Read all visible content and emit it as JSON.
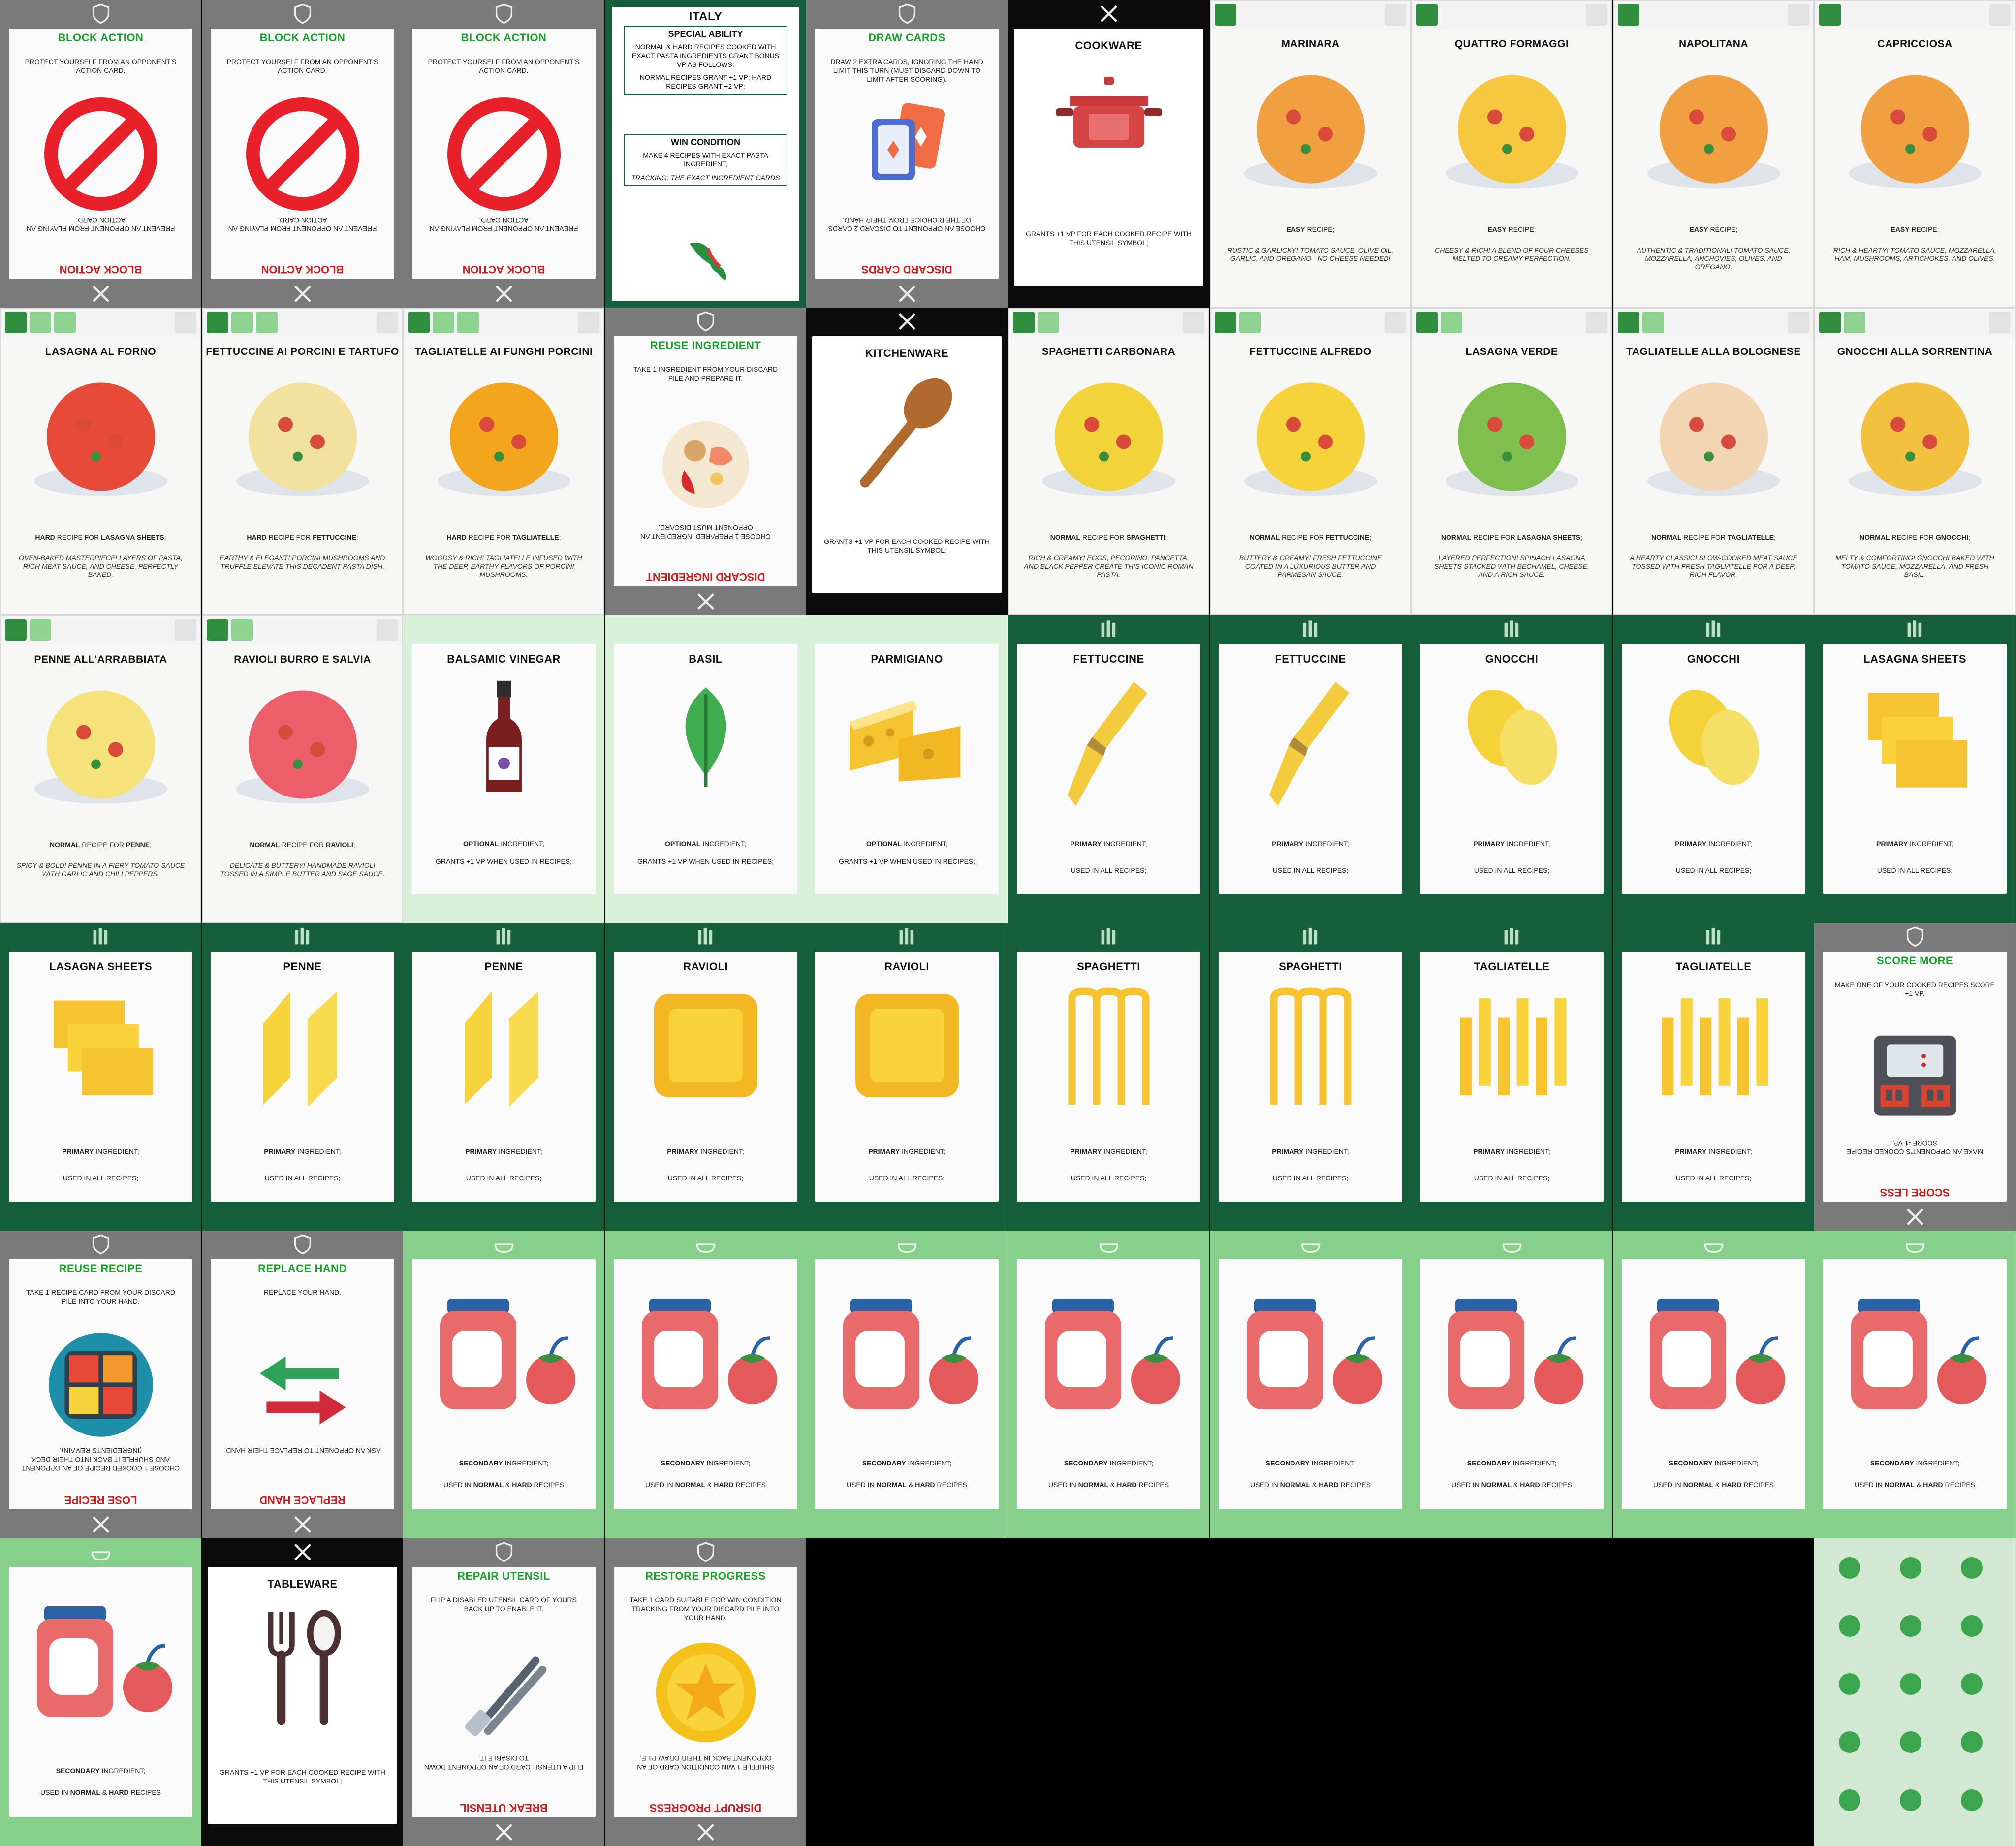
{
  "action_cards": [
    {
      "id": "a1",
      "title": "BLOCK ACTION",
      "desc": "PROTECT YOURSELF FROM AN OPPONENT'S ACTION CARD.",
      "inv_desc": "PREVENT AN OPPONENT FROM PLAYING AN ACTION CARD.",
      "inv_title": "BLOCK ACTION",
      "icon": "no-entry-icon"
    },
    {
      "id": "a2",
      "title": "BLOCK ACTION",
      "desc": "PROTECT YOURSELF FROM AN OPPONENT'S ACTION CARD.",
      "inv_desc": "PREVENT AN OPPONENT FROM PLAYING AN ACTION CARD.",
      "inv_title": "BLOCK ACTION",
      "icon": "no-entry-icon"
    },
    {
      "id": "a3",
      "title": "BLOCK ACTION",
      "desc": "PROTECT YOURSELF FROM AN OPPONENT'S ACTION CARD.",
      "inv_desc": "PREVENT AN OPPONENT FROM PLAYING AN ACTION CARD.",
      "inv_title": "BLOCK ACTION",
      "icon": "no-entry-icon"
    },
    {
      "id": "a4",
      "title": "DRAW CARDS",
      "desc": "DRAW 2 EXTRA CARDS, IGNORING THE HAND LIMIT THIS TURN (MUST DISCARD DOWN TO LIMIT AFTER SCORING).",
      "inv_desc": "CHOOSE AN OPPONENT TO DISCARD 2 CARDS OF THEIR CHOICE FROM THEIR HAND.",
      "inv_title": "DISCARD CARDS",
      "icon": "playing-cards-icon"
    },
    {
      "id": "a5",
      "title": "REUSE INGREDIENT",
      "desc": "TAKE 1 INGREDIENT FROM YOUR DISCARD PILE AND PREPARE IT.",
      "inv_desc": "CHOOSE 1 PREPARED INGREDIENT AN OPPONENT MUST DISCARD.",
      "inv_title": "DISCARD INGREDIENT",
      "icon": "ingredients-icon"
    },
    {
      "id": "a6",
      "title": "SCORE MORE",
      "desc": "MAKE ONE OF YOUR COOKED RECIPES SCORE +1 VP.",
      "inv_desc": "MAKE AN OPPONENT'S COOKED RECIPE SCORE -1 VP.",
      "inv_title": "SCORE LESS",
      "icon": "oven-icon"
    },
    {
      "id": "a7",
      "title": "REUSE RECIPE",
      "desc": "TAKE 1 RECIPE CARD FROM YOUR DISCARD PILE INTO YOUR HAND.",
      "inv_desc": "CHOOSE 1 COOKED RECIPE OF AN OPPONENT AND SHUFFLE IT BACK INTO THEIR DECK (INGREDIENTS REMAIN).",
      "inv_title": "LOSE RECIPE",
      "icon": "food-tray-icon"
    },
    {
      "id": "a8",
      "title": "REPLACE HAND",
      "desc": "REPLACE YOUR HAND.",
      "inv_desc": "ASK AN OPPONENT TO REPLACE THEIR HAND.",
      "inv_title": "REPLACE HAND",
      "icon": "swap-arrows-icon"
    },
    {
      "id": "a9",
      "title": "REPAIR UTENSIL",
      "desc": "FLIP A DISABLED UTENSIL CARD OF YOURS BACK UP TO ENABLE IT.",
      "inv_desc": "FLIP A UTENSIL CARD OF AN OPPONENT DOWN TO DISABLE IT.",
      "inv_title": "BREAK UTENSIL",
      "icon": "tongs-icon"
    },
    {
      "id": "a10",
      "title": "RESTORE PROGRESS",
      "desc": "TAKE 1 CARD SUITABLE FOR WIN CONDITION TRACKING FROM YOUR DISCARD PILE INTO YOUR HAND.",
      "inv_desc": "SHUFFLE 1 WIN CONDITION CARD OF AN OPPONENT BACK IN THEIR DRAW PILE.",
      "inv_title": "DISRUPT PROGRESS",
      "icon": "star-coin-icon"
    }
  ],
  "character": {
    "name": "ITALY",
    "ability_title": "SPECIAL ABILITY",
    "ability_text": "NORMAL & HARD RECIPES COOKED WITH EXACT PASTA INGREDIENTS GRANT BONUS VP AS FOLLOWS:",
    "ability_text2": "NORMAL RECIPES GRANT +1 VP; HARD RECIPES GRANT +2 VP;",
    "win_title": "WIN CONDITION",
    "win_text": "MAKE 4 RECIPES WITH EXACT PASTA INGREDIENT;",
    "win_text2": "TRACKING: THE EXACT INGREDIENT CARDS"
  },
  "utensils": [
    {
      "title": "COOKWARE",
      "desc": "GRANTS +1 VP FOR EACH COOKED RECIPE WITH THIS UTENSIL SYMBOL;",
      "icon": "pot-icon"
    },
    {
      "title": "KITCHENWARE",
      "desc": "GRANTS +1 VP FOR EACH COOKED RECIPE WITH THIS UTENSIL SYMBOL;",
      "icon": "wooden-spoon-icon"
    },
    {
      "title": "TABLEWARE",
      "desc": "GRANTS +1 VP FOR EACH COOKED RECIPE WITH THIS UTENSIL SYMBOL;",
      "icon": "fork-spoon-icon"
    }
  ],
  "recipes": [
    {
      "title": "MARINARA",
      "level": "EASY",
      "suffix": " RECIPE;",
      "flavor": "RUSTIC & GARLICKY! TOMATO SAUCE, OLIVE OIL, GARLIC, AND OREGANO - NO CHEESE NEEDED!",
      "color": "#f0a040"
    },
    {
      "title": "QUATTRO FORMAGGI",
      "level": "EASY",
      "suffix": " RECIPE;",
      "flavor": "CHEESY & RICH! A BLEND OF FOUR CHEESES MELTED TO CREAMY PERFECTION.",
      "color": "#f6c840"
    },
    {
      "title": "NAPOLITANA",
      "level": "EASY",
      "suffix": " RECIPE;",
      "flavor": "AUTHENTIC & TRADITIONAL! TOMATO SAUCE, MOZZARELLA, ANCHOVIES, OLIVES, AND OREGANO.",
      "color": "#f0a040"
    },
    {
      "title": "CAPRICCIOSA",
      "level": "EASY",
      "suffix": " RECIPE;",
      "flavor": "RICH & HEARTY! TOMATO SAUCE, MOZZARELLA, HAM, MUSHROOMS, ARTICHOKES, AND OLIVES.",
      "color": "#f0a040"
    },
    {
      "title": "LASAGNA AL FORNO",
      "level": "HARD",
      "suffix": " RECIPE FOR ",
      "pasta": "LASAGNA SHEETS",
      "flavor": "OVEN-BAKED MASTERPIECE! LAYERS OF PASTA, RICH MEAT SAUCE, AND CHEESE, PERFECTLY BAKED.",
      "color": "#e84a3a"
    },
    {
      "title": "FETTUCCINE AI PORCINI E TARTUFO",
      "level": "HARD",
      "suffix": " RECIPE FOR ",
      "pasta": "FETTUCCINE",
      "flavor": "EARTHY & ELEGANT! PORCINI MUSHROOMS AND TRUFFLE ELEVATE THIS DECADENT PASTA DISH.",
      "color": "#f2e2a0"
    },
    {
      "title": "TAGLIATELLE AI FUNGHI PORCINI",
      "level": "HARD",
      "suffix": " RECIPE FOR ",
      "pasta": "TAGLIATELLE",
      "flavor": "WOODSY & RICH! TAGLIATELLE INFUSED WITH THE DEEP, EARTHY FLAVORS OF PORCINI MUSHROOMS.",
      "color": "#f3a51e"
    },
    {
      "title": "SPAGHETTI CARBONARA",
      "level": "NORMAL",
      "suffix": " RECIPE FOR ",
      "pasta": "SPAGHETTI",
      "flavor": "RICH & CREAMY! EGGS, PECORINO, PANCETTA, AND BLACK PEPPER CREATE THIS ICONIC ROMAN PASTA.",
      "color": "#f3d33a"
    },
    {
      "title": "FETTUCCINE ALFREDO",
      "level": "NORMAL",
      "suffix": " RECIPE FOR ",
      "pasta": "FETTUCCINE",
      "flavor": "BUTTERY & CREAMY! FRESH FETTUCCINE COATED IN A LUXURIOUS BUTTER AND PARMESAN SAUCE.",
      "color": "#f6d33a"
    },
    {
      "title": "LASAGNA VERDE",
      "level": "NORMAL",
      "suffix": " RECIPE FOR ",
      "pasta": "LASAGNA SHEETS",
      "flavor": "LAYERED PERFECTION! SPINACH LASAGNA SHEETS STACKED WITH BECHAMEL, CHEESE, AND A RICH SAUCE.",
      "color": "#7fbf4d"
    },
    {
      "title": "TAGLIATELLE ALLA BOLOGNESE",
      "level": "NORMAL",
      "suffix": " RECIPE FOR ",
      "pasta": "TAGLIATELLE",
      "flavor": "A HEARTY CLASSIC! SLOW-COOKED MEAT SAUCE TOSSED WITH FRESH TAGLIATELLE FOR A DEEP, RICH FLAVOR.",
      "color": "#f2d6b3"
    },
    {
      "title": "GNOCCHI ALLA SORRENTINA",
      "level": "NORMAL",
      "suffix": " RECIPE FOR ",
      "pasta": "GNOCCHI",
      "flavor": "MELTY & COMFORTING! GNOCCHI BAKED WITH TOMATO SAUCE, MOZZARELLA, AND FRESH BASIL.",
      "color": "#f3c140"
    },
    {
      "title": "PENNE ALL'ARRABBIATA",
      "level": "NORMAL",
      "suffix": " RECIPE FOR ",
      "pasta": "PENNE",
      "flavor": "SPICY & BOLD! PENNE IN A FIERY TOMATO SAUCE WITH GARLIC AND CHILI PEPPERS.",
      "color": "#f6e27a"
    },
    {
      "title": "RAVIOLI BURRO E SALVIA",
      "level": "NORMAL",
      "suffix": " RECIPE FOR ",
      "pasta": "RAVIOLI",
      "flavor": "DELICATE & BUTTERY! HANDMADE RAVIOLI TOSSED IN A SIMPLE BUTTER AND SAGE SAUCE.",
      "color": "#ec5f6a"
    }
  ],
  "optional": [
    {
      "title": "BALSAMIC VINEGAR",
      "kind": "OPTIONAL",
      "rest": " INGREDIENT;",
      "grant": "GRANTS +1 VP WHEN USED IN RECIPES;",
      "icon": "vinegar-bottle-icon"
    },
    {
      "title": "BASIL",
      "kind": "OPTIONAL",
      "rest": " INGREDIENT;",
      "grant": "GRANTS +1 VP WHEN USED IN RECIPES;",
      "icon": "basil-leaf-icon"
    },
    {
      "title": "PARMIGIANO",
      "kind": "OPTIONAL",
      "rest": " INGREDIENT;",
      "grant": "GRANTS +1 VP WHEN USED IN RECIPES;",
      "icon": "cheese-icon"
    }
  ],
  "primary": [
    {
      "title": "FETTUCCINE",
      "icon": "fettuccine-icon"
    },
    {
      "title": "FETTUCCINE",
      "icon": "fettuccine-icon"
    },
    {
      "title": "GNOCCHI",
      "icon": "gnocchi-icon"
    },
    {
      "title": "GNOCCHI",
      "icon": "gnocchi-icon"
    },
    {
      "title": "LASAGNA SHEETS",
      "icon": "lasagna-sheets-icon"
    },
    {
      "title": "LASAGNA SHEETS",
      "icon": "lasagna-sheets-icon"
    },
    {
      "title": "PENNE",
      "icon": "penne-icon"
    },
    {
      "title": "PENNE",
      "icon": "penne-icon"
    },
    {
      "title": "RAVIOLI",
      "icon": "ravioli-icon"
    },
    {
      "title": "RAVIOLI",
      "icon": "ravioli-icon"
    },
    {
      "title": "SPAGHETTI",
      "icon": "spaghetti-icon"
    },
    {
      "title": "SPAGHETTI",
      "icon": "spaghetti-icon"
    },
    {
      "title": "TAGLIATELLE",
      "icon": "tagliatelle-icon"
    },
    {
      "title": "TAGLIATELLE",
      "icon": "tagliatelle-icon"
    }
  ],
  "primary_text": {
    "kind": "PRIMARY",
    "rest": " INGREDIENT;",
    "used": "USED IN ALL RECIPES;"
  },
  "secondary_text": {
    "kind": "SECONDARY",
    "rest": " INGREDIENT;",
    "used_pre": "USED IN ",
    "normal": "NORMAL",
    "amp": " & ",
    "hard": "HARD",
    "used_post": " RECIPES"
  },
  "colors": {
    "action_bg": "#7a7a7a",
    "action_title": "#17a12a",
    "inverse_title": "#d11919",
    "primary_bg": "#15603a",
    "secondary_bg": "#86d08b",
    "optional_bg": "#d9f0d9",
    "utensil_bg": "#0b0b0b"
  }
}
